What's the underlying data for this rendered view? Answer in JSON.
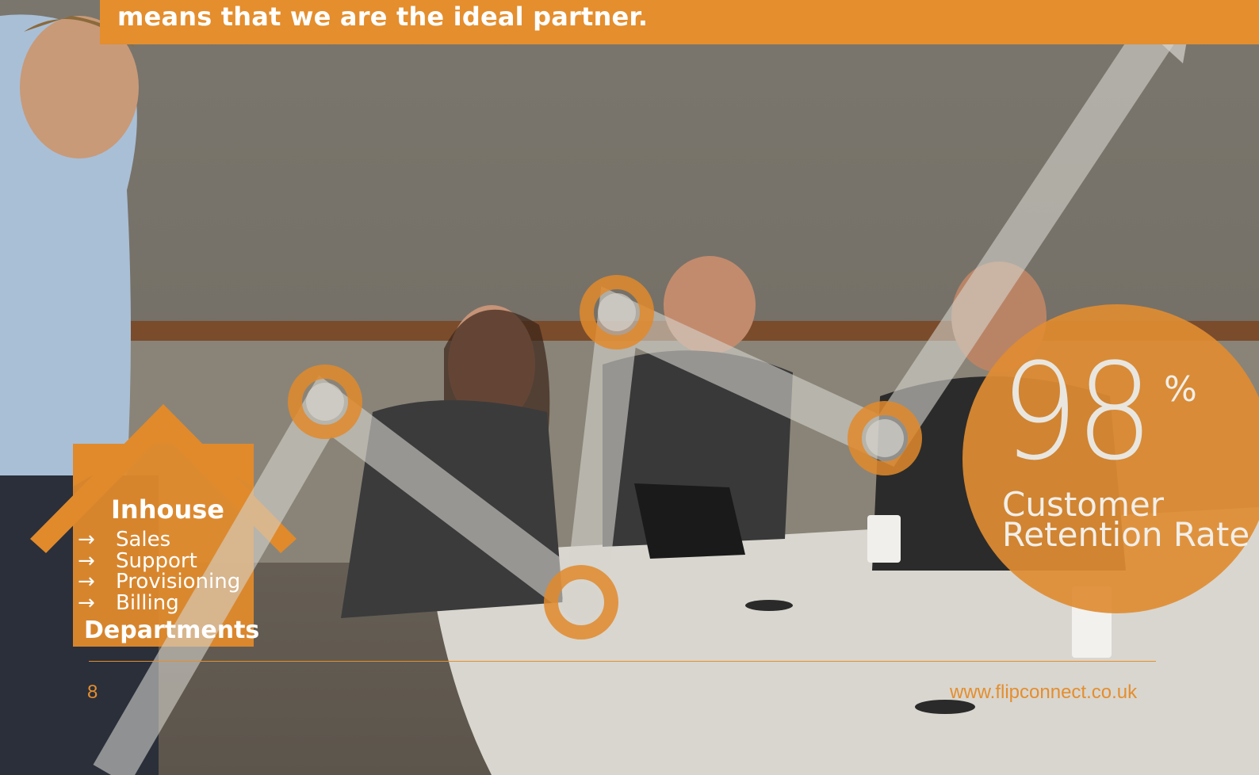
{
  "header": {
    "tagline": "means that we are the ideal partner."
  },
  "house": {
    "title": "Inhouse",
    "items": [
      {
        "arrow": "→",
        "label": "Sales"
      },
      {
        "arrow": "→",
        "label": "Support"
      },
      {
        "arrow": "→",
        "label": "Provisioning"
      },
      {
        "arrow": "→",
        "label": "Billing"
      }
    ],
    "footer": "Departments"
  },
  "stat": {
    "value": "98",
    "unit": "%",
    "label_line1": "Customer",
    "label_line2": "Retention Rate"
  },
  "footer": {
    "page_number": "8",
    "url": "www.flipconnect.co.uk"
  },
  "colors": {
    "accent": "#e48e2e",
    "white": "#ffffff",
    "overlay_line": "#c9c6c0"
  }
}
